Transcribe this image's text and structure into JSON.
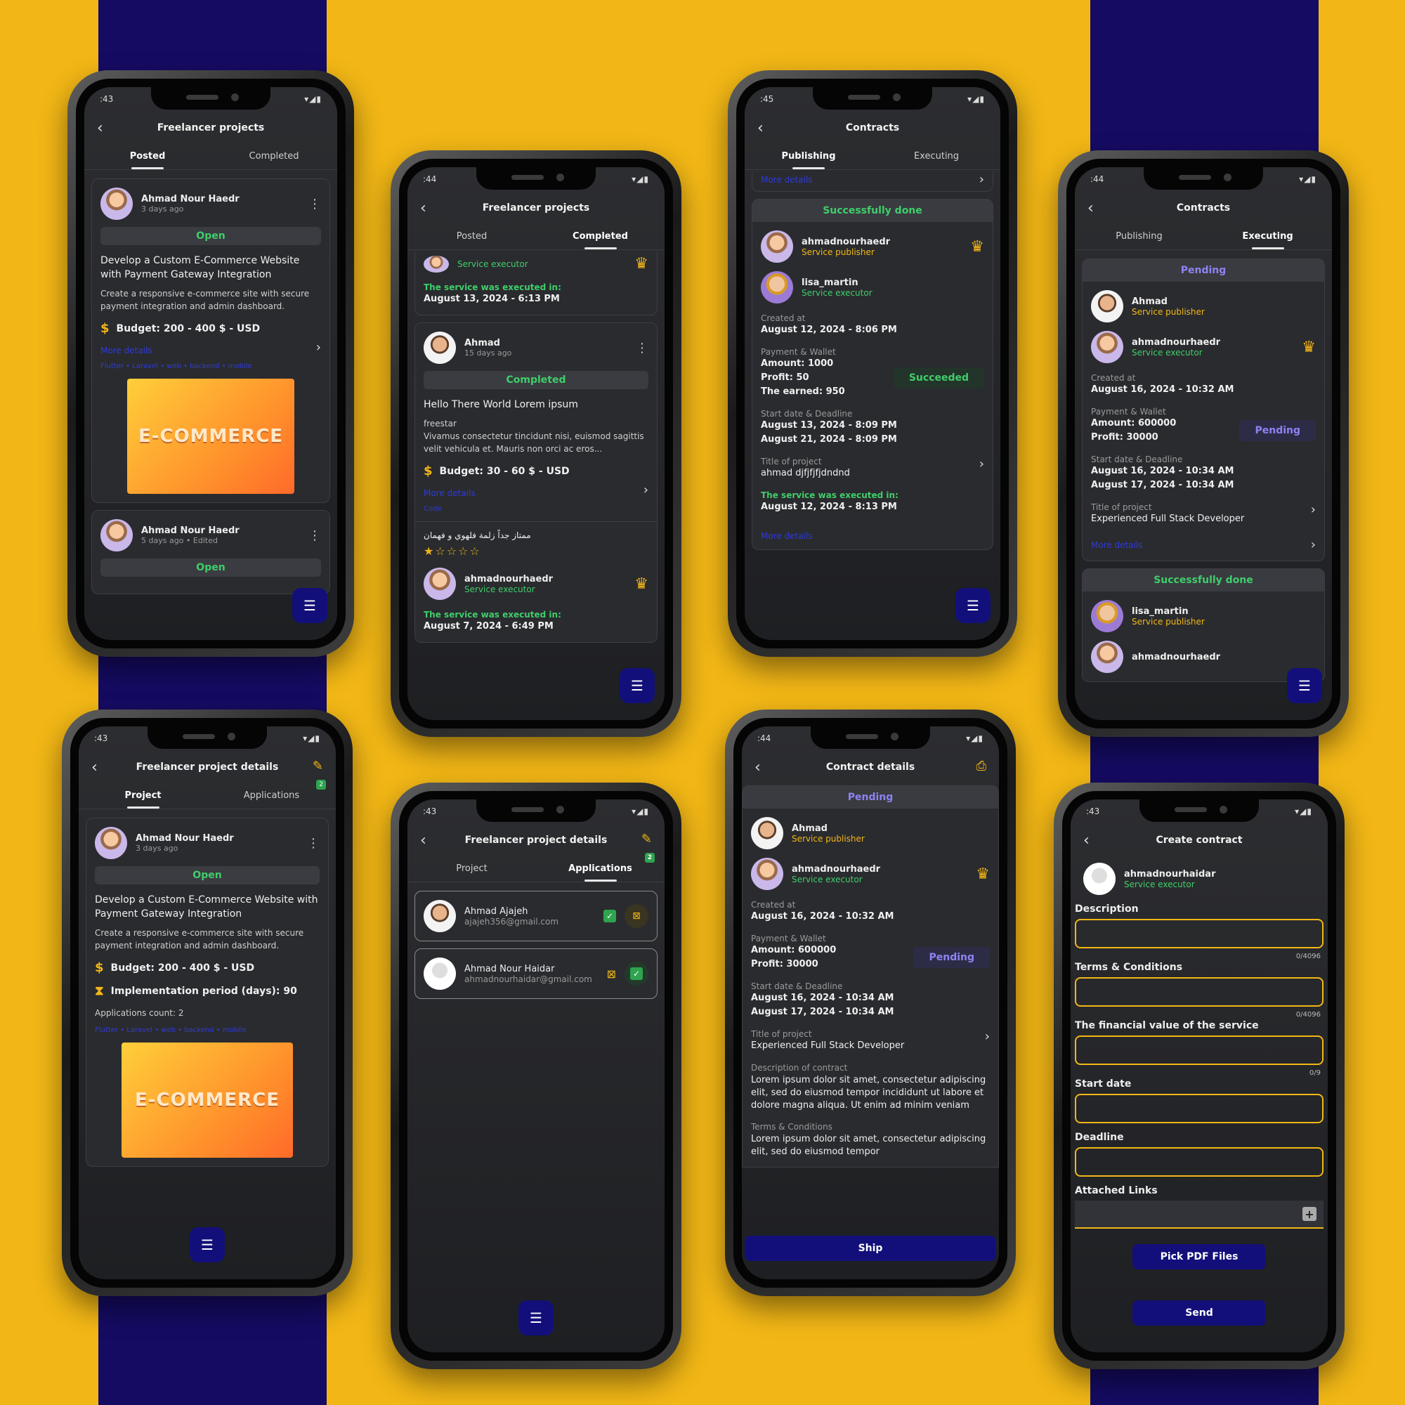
{
  "colors": {
    "yellow": "#f2b716",
    "navy": "#150b63",
    "green": "#3fce6a",
    "purple": "#8d83f2",
    "link": "#2f3ad8"
  },
  "status_times": {
    "p1": ":43",
    "p2": ":44",
    "p3": ":45",
    "p4": ":44",
    "p5": ":43",
    "p6": ":43",
    "p7": ":44",
    "p8": ":43"
  },
  "icons": {
    "back": "‹",
    "kebab": "⋮",
    "crown": "♛",
    "budget": "$",
    "hourglass": "⧗",
    "filter": "☰",
    "chevron": "›",
    "print": "⎙",
    "edit": "✎",
    "check": "✓",
    "plus": "+"
  },
  "p1": {
    "title": "Freelancer projects",
    "tabs": [
      "Posted",
      "Completed"
    ],
    "card": {
      "name": "Ahmad Nour Haedr",
      "time": "3 days ago",
      "status": "Open",
      "title": "Develop a Custom E-Commerce Website with Payment Gateway Integration",
      "desc": "Create a responsive e-commerce site with secure payment integration and admin dashboard.",
      "budget": "Budget: 200 - 400 $ - USD",
      "more": "More details",
      "tags": "Flutter • Laravel • web • backend • mobile",
      "image_text": "E-COMMERCE"
    },
    "card2": {
      "name": "Ahmad Nour Haedr",
      "time": "5 days ago • Edited",
      "status": "Open"
    }
  },
  "p2": {
    "title": "Freelancer projects",
    "tabs": [
      "Posted",
      "Completed"
    ],
    "top": {
      "role": "Service executor",
      "exec_label": "The service was executed in:",
      "exec_date": "August 13, 2024 - 6:13 PM"
    },
    "card": {
      "name": "Ahmad",
      "time": "15 days ago",
      "status": "Completed",
      "title": "Hello There World Lorem ipsum",
      "desc_user": "freestar",
      "desc": "Vivamus consectetur tincidunt nisi, euismod sagittis velit vehicula et. Mauris non orci ac eros...",
      "budget": "Budget: 30 - 60 $ - USD",
      "more": "More details",
      "tag": "Code",
      "review": "ممتاز جداً زلمة فلهوي و فهمان",
      "stars": "★☆☆☆☆",
      "exec_name": "ahmadnourhaedr",
      "exec_role": "Service executor",
      "exec_label": "The service was executed in:",
      "exec_date": "August 7, 2024 - 6:49 PM"
    }
  },
  "p3": {
    "title": "Contracts",
    "tabs": [
      "Publishing",
      "Executing"
    ],
    "more_top": "More details",
    "card": {
      "head": "Successfully done",
      "pub_name": "ahmadnourhaedr",
      "pub_role": "Service publisher",
      "exe_name": "lisa_martin",
      "exe_role": "Service executor",
      "created_label": "Created at",
      "created": "August 12, 2024 - 8:06 PM",
      "pay_label": "Payment & Wallet",
      "amount": "Amount: 1000",
      "profit": "Profit: 50",
      "earned": "The earned: 950",
      "pay_status": "Succeeded",
      "dates_label": "Start date & Deadline",
      "start": "August 13, 2024 - 8:09 PM",
      "deadline": "August 21, 2024 - 8:09 PM",
      "proj_label": "Title of project",
      "proj": "ahmad djfjfjfjdndnd",
      "exec_label": "The service was executed in:",
      "exec_date": "August 12, 2024 - 8:13 PM",
      "more": "More details"
    }
  },
  "p4": {
    "title": "Contracts",
    "tabs": [
      "Publishing",
      "Executing"
    ],
    "card": {
      "head": "Pending",
      "pub_name": "Ahmad",
      "pub_role": "Service publisher",
      "exe_name": "ahmadnourhaedr",
      "exe_role": "Service executor",
      "created_label": "Created at",
      "created": "August 16, 2024 - 10:32 AM",
      "pay_label": "Payment & Wallet",
      "amount": "Amount: 600000",
      "profit": "Profit: 30000",
      "pay_status": "Pending",
      "dates_label": "Start date & Deadline",
      "start": "August 16, 2024 - 10:34 AM",
      "deadline": "August 17, 2024 - 10:34 AM",
      "proj_label": "Title of project",
      "proj": "Experienced Full Stack Developer",
      "more": "More details"
    },
    "card2": {
      "head": "Successfully done",
      "pub_name": "lisa_martin",
      "pub_role": "Service publisher",
      "exe_name": "ahmadnourhaedr"
    }
  },
  "p5": {
    "title": "Freelancer project details",
    "tabs": [
      "Project",
      "Applications"
    ],
    "badge": "2",
    "card": {
      "name": "Ahmad Nour Haedr",
      "time": "3 days ago",
      "status": "Open",
      "title": "Develop a Custom E-Commerce Website with Payment Gateway Integration",
      "desc": "Create a responsive e-commerce site with secure payment integration and admin dashboard.",
      "budget": "Budget: 200 - 400 $ - USD",
      "period": "Implementation period (days): 90",
      "apps": "Applications count: 2",
      "tags": "Flutter • Laravel • web • backend • mobile",
      "image_text": "E-COMMERCE"
    }
  },
  "p6": {
    "title": "Freelancer project details",
    "tabs": [
      "Project",
      "Applications"
    ],
    "badge": "2",
    "apps": [
      {
        "name": "Ahmad Ajajeh",
        "email": "ajajeh356@gmail.com"
      },
      {
        "name": "Ahmad Nour Haidar",
        "email": "ahmadnourhaidar@gmail.com"
      }
    ]
  },
  "p7": {
    "title": "Contract details",
    "card": {
      "head": "Pending",
      "pub_name": "Ahmad",
      "pub_role": "Service publisher",
      "exe_name": "ahmadnourhaedr",
      "exe_role": "Service executor",
      "created_label": "Created at",
      "created": "August 16, 2024 - 10:32 AM",
      "pay_label": "Payment & Wallet",
      "amount": "Amount: 600000",
      "profit": "Profit: 30000",
      "pay_status": "Pending",
      "dates_label": "Start date & Deadline",
      "start": "August 16, 2024 - 10:34 AM",
      "deadline": "August 17, 2024 - 10:34 AM",
      "proj_label": "Title of project",
      "proj": "Experienced Full Stack Developer",
      "desc_label": "Description of contract",
      "desc": "Lorem ipsum dolor sit amet, consectetur adipiscing elit, sed do eiusmod tempor incididunt ut labore et dolore magna aliqua. Ut enim ad minim veniam",
      "terms_label": "Terms & Conditions",
      "terms": "Lorem ipsum dolor sit amet, consectetur adipiscing elit, sed do eiusmod tempor"
    },
    "ship": "Ship"
  },
  "p8": {
    "title": "Create contract",
    "name": "ahmadnourhaidar",
    "role": "Service executor",
    "fields": {
      "description": "Description",
      "terms": "Terms & Conditions",
      "value": "The financial value of the service",
      "start": "Start date",
      "deadline": "Deadline",
      "links": "Attached Links"
    },
    "counts": {
      "c1": "0/4096",
      "c2": "0/4096",
      "c3": "0/9"
    },
    "pick": "Pick PDF Files",
    "send": "Send"
  }
}
